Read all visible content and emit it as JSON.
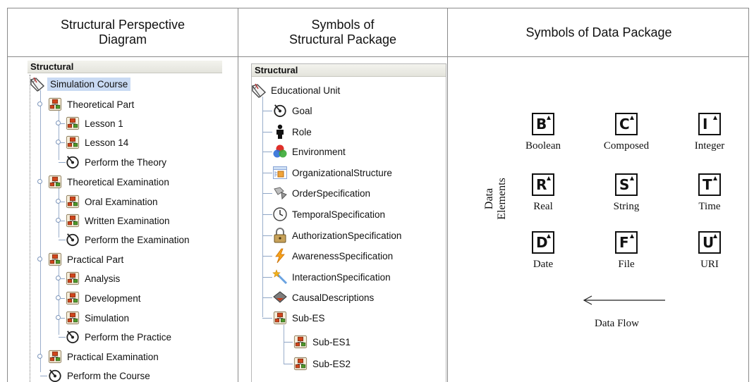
{
  "headers": {
    "col1": [
      "Structural Perspective",
      "Diagram"
    ],
    "col2": [
      "Symbols of",
      "Structural Package"
    ],
    "col3": "Symbols of Data Package"
  },
  "perspective_tree": {
    "title": "Structural",
    "items": [
      {
        "label": "Simulation Course",
        "icon": "educational-unit-icon",
        "selected": true
      },
      {
        "label": "Theoretical Part",
        "icon": "sub-es-icon"
      },
      {
        "label": "Lesson 1",
        "icon": "sub-es-icon"
      },
      {
        "label": "Lesson 14",
        "icon": "sub-es-icon"
      },
      {
        "label": "Perform the Theory",
        "icon": "goal-icon"
      },
      {
        "label": "Theoretical Examination",
        "icon": "sub-es-icon"
      },
      {
        "label": "Oral Examination",
        "icon": "sub-es-icon"
      },
      {
        "label": "Written Examination",
        "icon": "sub-es-icon"
      },
      {
        "label": "Perform the Examination",
        "icon": "goal-icon"
      },
      {
        "label": "Practical Part",
        "icon": "sub-es-icon"
      },
      {
        "label": "Analysis",
        "icon": "sub-es-icon"
      },
      {
        "label": "Development",
        "icon": "sub-es-icon"
      },
      {
        "label": "Simulation",
        "icon": "sub-es-icon"
      },
      {
        "label": "Perform the Practice",
        "icon": "goal-icon"
      },
      {
        "label": "Practical Examination",
        "icon": "sub-es-icon"
      },
      {
        "label": "Perform the Course",
        "icon": "goal-icon"
      }
    ]
  },
  "structural_package": {
    "title": "Structural",
    "items": [
      {
        "label": "Educational Unit",
        "icon": "educational-unit-icon"
      },
      {
        "label": "Goal",
        "icon": "goal-icon"
      },
      {
        "label": "Role",
        "icon": "role-icon"
      },
      {
        "label": "Environment",
        "icon": "environment-icon"
      },
      {
        "label": "OrganizationalStructure",
        "icon": "organizational-structure-icon"
      },
      {
        "label": "OrderSpecification",
        "icon": "order-specification-icon"
      },
      {
        "label": "TemporalSpecification",
        "icon": "clock-icon"
      },
      {
        "label": "AuthorizationSpecification",
        "icon": "lock-icon"
      },
      {
        "label": "AwarenessSpecification",
        "icon": "lightning-icon"
      },
      {
        "label": "InteractionSpecification",
        "icon": "magic-wand-icon"
      },
      {
        "label": "CausalDescriptions",
        "icon": "causal-icon"
      },
      {
        "label": "Sub-ES",
        "icon": "sub-es-icon"
      },
      {
        "label": "Sub-ES1",
        "icon": "sub-es-icon"
      },
      {
        "label": "Sub-ES2",
        "icon": "sub-es-icon"
      }
    ]
  },
  "data_package": {
    "side_label": [
      "Data",
      "Elements"
    ],
    "flow_label": "Data Flow",
    "symbols": [
      {
        "letter": "B",
        "name": "Boolean"
      },
      {
        "letter": "C",
        "name": "Composed"
      },
      {
        "letter": "I",
        "name": "Integer"
      },
      {
        "letter": "R",
        "name": "Real"
      },
      {
        "letter": "S",
        "name": "String"
      },
      {
        "letter": "T",
        "name": "Time"
      },
      {
        "letter": "D",
        "name": "Date"
      },
      {
        "letter": "F",
        "name": "File"
      },
      {
        "letter": "U",
        "name": "URI"
      }
    ]
  }
}
